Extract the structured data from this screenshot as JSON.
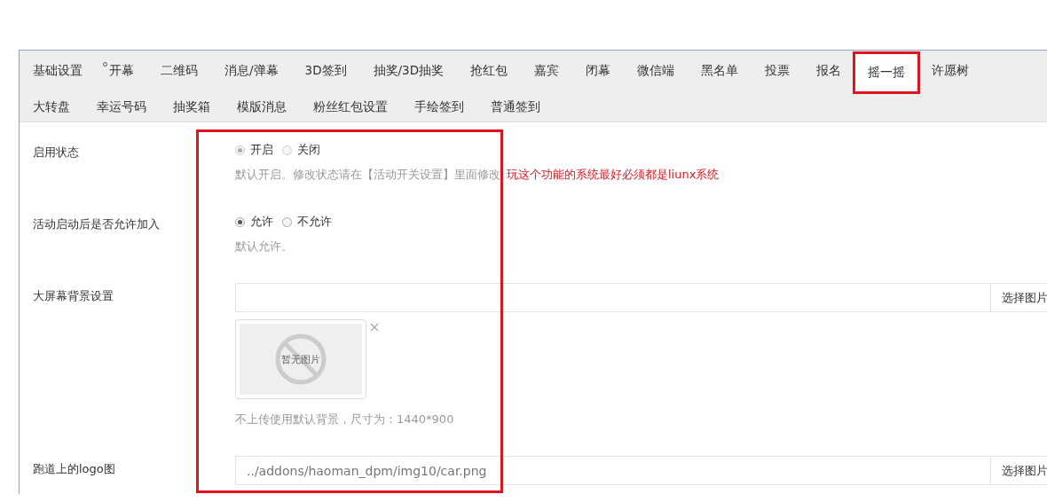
{
  "tab_rows": [
    [
      {
        "label": "基础设置",
        "selected": false,
        "highlighted": false,
        "dot": false
      },
      {
        "label": "开幕",
        "selected": false,
        "highlighted": false,
        "dot": true
      },
      {
        "label": "二维码",
        "selected": false,
        "highlighted": false,
        "dot": false
      },
      {
        "label": "消息/弹幕",
        "selected": false,
        "highlighted": false,
        "dot": false
      },
      {
        "label": "3D签到",
        "selected": false,
        "highlighted": false,
        "dot": false
      },
      {
        "label": "抽奖/3D抽奖",
        "selected": false,
        "highlighted": false,
        "dot": false
      },
      {
        "label": "抢红包",
        "selected": false,
        "highlighted": false,
        "dot": false
      },
      {
        "label": "嘉宾",
        "selected": false,
        "highlighted": false,
        "dot": false
      },
      {
        "label": "闭幕",
        "selected": false,
        "highlighted": false,
        "dot": false
      },
      {
        "label": "微信端",
        "selected": false,
        "highlighted": false,
        "dot": false
      },
      {
        "label": "黑名单",
        "selected": false,
        "highlighted": false,
        "dot": false
      },
      {
        "label": "投票",
        "selected": false,
        "highlighted": false,
        "dot": false
      },
      {
        "label": "报名",
        "selected": false,
        "highlighted": false,
        "dot": false
      },
      {
        "label": "摇一摇",
        "selected": true,
        "highlighted": true,
        "dot": false
      },
      {
        "label": "许愿树",
        "selected": false,
        "highlighted": false,
        "dot": false
      }
    ],
    [
      {
        "label": "大转盘",
        "selected": false,
        "highlighted": false,
        "dot": false
      },
      {
        "label": "幸运号码",
        "selected": false,
        "highlighted": false,
        "dot": false
      },
      {
        "label": "抽奖箱",
        "selected": false,
        "highlighted": false,
        "dot": false
      },
      {
        "label": "模版消息",
        "selected": false,
        "highlighted": false,
        "dot": false
      },
      {
        "label": "粉丝红包设置",
        "selected": false,
        "highlighted": false,
        "dot": false
      },
      {
        "label": "手绘签到",
        "selected": false,
        "highlighted": false,
        "dot": false
      },
      {
        "label": "普通签到",
        "selected": false,
        "highlighted": false,
        "dot": false
      }
    ]
  ],
  "form": {
    "highlighted": true,
    "rows": [
      {
        "kind": "radio",
        "label": "启用状态",
        "disabled": true,
        "options": [
          {
            "label": "开启",
            "selected": true
          },
          {
            "label": "关闭",
            "selected": false
          }
        ],
        "help": "默认开启。修改状态请在【活动开关设置】里面修改",
        "warning": "玩这个功能的系统最好必须都是liunx系统"
      },
      {
        "kind": "radio",
        "label": "活动启动后是否允许加入",
        "disabled": false,
        "options": [
          {
            "label": "允许",
            "selected": true
          },
          {
            "label": "不允许",
            "selected": false
          }
        ],
        "help": "默认允许。"
      },
      {
        "kind": "image",
        "label": "大屏幕背景设置",
        "button": "选择图片",
        "preview_text": "暂无图片",
        "help": "不上传使用默认背景，尺寸为：1440*900"
      },
      {
        "kind": "file",
        "label": "跑道上的logo图",
        "value": "../addons/haoman_dpm/img10/car.png",
        "button": "选择图片"
      }
    ]
  }
}
